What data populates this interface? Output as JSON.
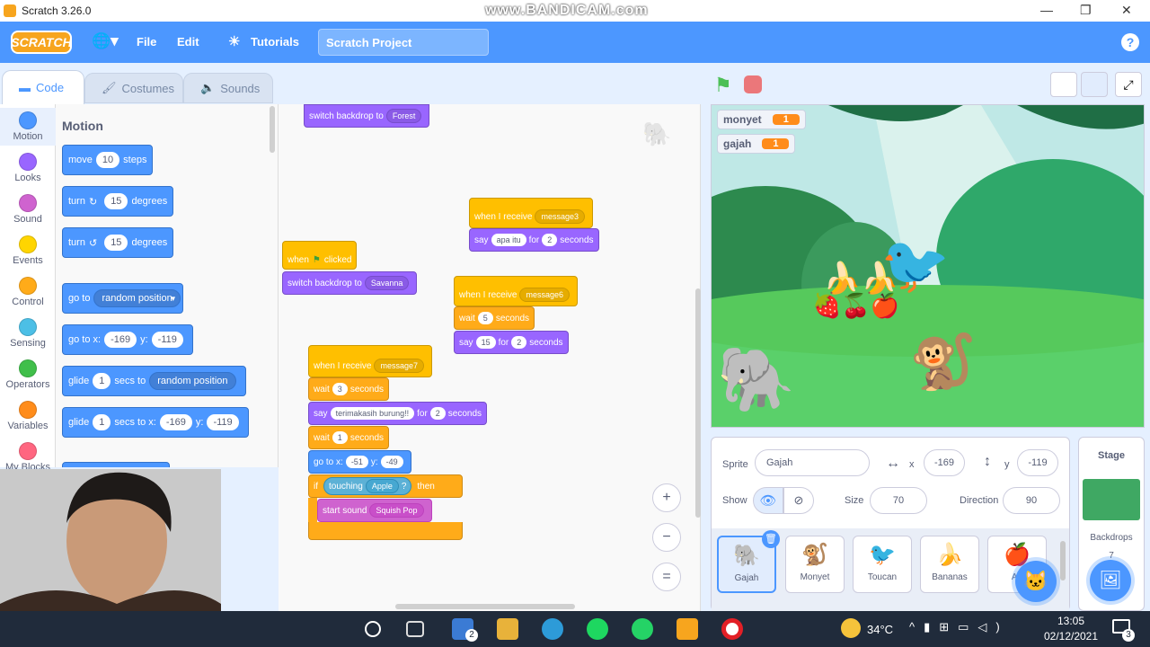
{
  "window": {
    "title": "Scratch 3.26.0",
    "watermark": "www.BANDICAM.com"
  },
  "menu": {
    "logo": "SCRATCH",
    "file": "File",
    "edit": "Edit",
    "tutorials": "Tutorials",
    "project_title": "Scratch Project",
    "help": "?"
  },
  "tabs": {
    "code": "Code",
    "costumes": "Costumes",
    "sounds": "Sounds"
  },
  "categories": [
    {
      "label": "Motion",
      "color": "#4c97ff"
    },
    {
      "label": "Looks",
      "color": "#9966ff"
    },
    {
      "label": "Sound",
      "color": "#cf63cf"
    },
    {
      "label": "Events",
      "color": "#ffd500"
    },
    {
      "label": "Control",
      "color": "#ffab19"
    },
    {
      "label": "Sensing",
      "color": "#4cbfe6"
    },
    {
      "label": "Operators",
      "color": "#40bf4a"
    },
    {
      "label": "Variables",
      "color": "#ff8c1a"
    },
    {
      "label": "My Blocks",
      "color": "#ff6680"
    }
  ],
  "palette": {
    "title": "Motion",
    "move": {
      "a": "move",
      "v": "10",
      "b": "steps"
    },
    "turn_right": {
      "a": "turn",
      "icon": "↻",
      "v": "15",
      "b": "degrees"
    },
    "turn_left": {
      "a": "turn",
      "icon": "↺",
      "v": "15",
      "b": "degrees"
    },
    "goto": {
      "a": "go to",
      "dd": "random position"
    },
    "goto_xy": {
      "a": "go to x:",
      "x": "-169",
      "b": "y:",
      "y": "-119"
    },
    "glide": {
      "a": "glide",
      "v": "1",
      "b": "secs to",
      "dd": "random position"
    },
    "glide_xy": {
      "a": "glide",
      "v": "1",
      "b": "secs to x:",
      "x": "-169",
      "c": "y:",
      "y": "-119"
    }
  },
  "code": {
    "top_backdrop": {
      "a": "switch backdrop to",
      "dd": "Forest"
    },
    "script1": {
      "hat_a": "when",
      "hat_b": "clicked",
      "b1_a": "switch backdrop to",
      "b1_dd": "Savanna"
    },
    "script2": {
      "hat": "when I receive",
      "hat_dd": "message3",
      "say": "say",
      "msg": "apa itu",
      "for": "for",
      "secs": "2",
      "secs_lbl": "seconds"
    },
    "script3": {
      "hat": "when I receive",
      "hat_dd": "message6",
      "wait": "wait",
      "wait_v": "5",
      "wait_lbl": "seconds",
      "say": "say",
      "msg": "15",
      "for": "for",
      "secs": "2",
      "secs_lbl": "seconds"
    },
    "script4": {
      "hat": "when I receive",
      "hat_dd": "message7",
      "wait1": "wait",
      "wait1_v": "3",
      "wait1_lbl": "seconds",
      "say": "say",
      "msg": "terimakasih burung!!",
      "for": "for",
      "secs": "2",
      "secs_lbl": "seconds",
      "wait2": "wait",
      "wait2_v": "1",
      "wait2_lbl": "seconds",
      "goto": "go to x:",
      "x": "-51",
      "y_lbl": "y:",
      "y": "-49",
      "if": "if",
      "touching": "touching",
      "touch_dd": "Apple",
      "q": "?",
      "then": "then",
      "sound": "start sound",
      "sound_dd": "Squish Pop"
    }
  },
  "zoom": {
    "in": "+",
    "out": "−",
    "reset": "="
  },
  "stage": {
    "monitors": [
      {
        "label": "monyet",
        "value": "1"
      },
      {
        "label": "gajah",
        "value": "1"
      }
    ]
  },
  "sprite_info": {
    "sprite_lbl": "Sprite",
    "name": "Gajah",
    "x_lbl": "x",
    "x": "-169",
    "y_lbl": "y",
    "y": "-119",
    "show_lbl": "Show",
    "size_lbl": "Size",
    "size": "70",
    "direction_lbl": "Direction",
    "direction": "90"
  },
  "sprites": [
    {
      "name": "Gajah",
      "icon": "🐘"
    },
    {
      "name": "Monyet",
      "icon": "🐒"
    },
    {
      "name": "Toucan",
      "icon": "🐦"
    },
    {
      "name": "Bananas",
      "icon": "🍌"
    },
    {
      "name": "Ap",
      "icon": "🍎"
    }
  ],
  "stage_panel": {
    "title": "Stage",
    "backdrops_lbl": "Backdrops",
    "backdrops_count": "7"
  },
  "taskbar": {
    "temp": "34°C",
    "time": "13:05",
    "date": "02/12/2021",
    "mail_badge": "2",
    "notif_badge": "3"
  }
}
